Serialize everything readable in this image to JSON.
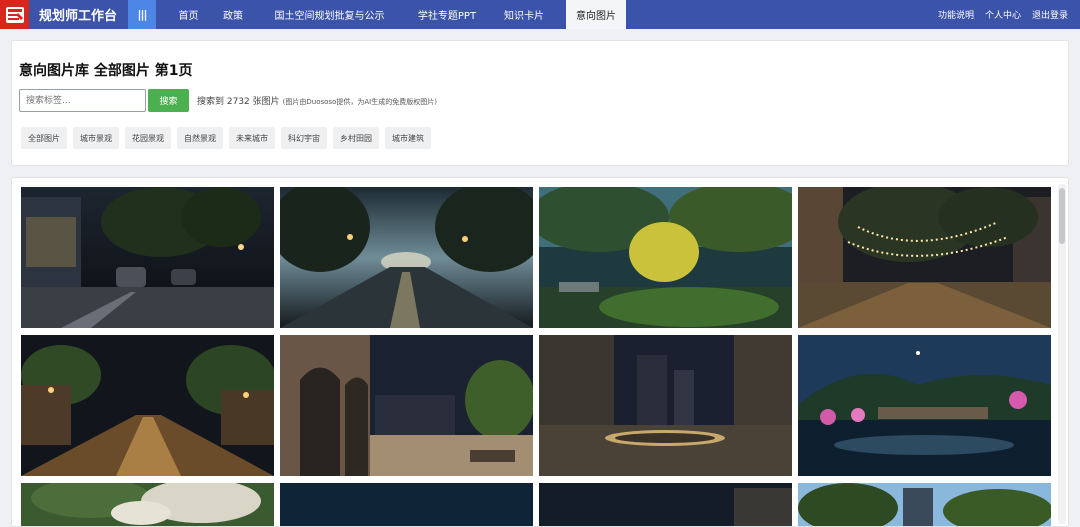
{
  "app": {
    "brand": "规划师工作台",
    "menu_icon": "|||"
  },
  "nav": {
    "items": [
      {
        "label": "首页"
      },
      {
        "label": "政策"
      },
      {
        "label": "国土空间规划批复与公示"
      },
      {
        "label": "学社专题PPT"
      },
      {
        "label": "知识卡片"
      },
      {
        "label": "意向图片"
      }
    ],
    "active": "意向图片",
    "right": [
      {
        "label": "功能说明"
      },
      {
        "label": "个人中心"
      },
      {
        "label": "退出登录"
      }
    ]
  },
  "page": {
    "title": "意向图片库 全部图片 第1页",
    "search_placeholder": "搜索标签...",
    "search_button": "搜索",
    "result_text": "搜索到 2732 张图片",
    "result_note": "(图片由Duososo提供，为AI生成的免费版权图片)",
    "tags": [
      "全部图片",
      "城市景观",
      "花园景观",
      "自然景观",
      "未来城市",
      "科幻宇宙",
      "乡村田园",
      "城市建筑"
    ]
  },
  "gallery": {
    "images": [
      {
        "name": "rainy-city-street-night"
      },
      {
        "name": "foggy-tree-lined-road-night"
      },
      {
        "name": "plaza-lit-trees-night"
      },
      {
        "name": "street-string-lights-night"
      },
      {
        "name": "lamp-lit-boulevard-night"
      },
      {
        "name": "arcade-square-night"
      },
      {
        "name": "city-plaza-circular-bench-night"
      },
      {
        "name": "lakeside-village-blossoms-night"
      },
      {
        "name": "blossom-trees-daytime"
      },
      {
        "name": "dark-night-sky"
      },
      {
        "name": "dark-city-skyline"
      },
      {
        "name": "trees-tower-blue-sky"
      }
    ]
  },
  "colors": {
    "nav_bg": "#3b53a8",
    "logo_bg": "#d9261c",
    "menu_btn": "#4e86e6",
    "search_btn": "#4caf50"
  }
}
